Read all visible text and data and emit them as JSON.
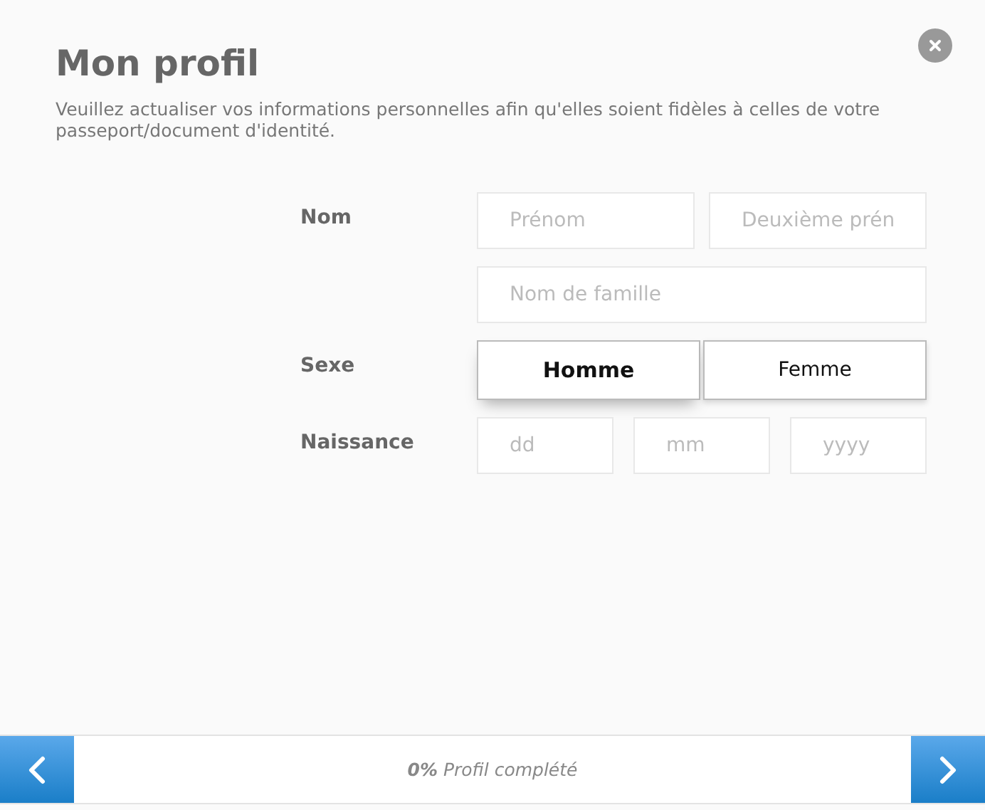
{
  "title": "Mon profil",
  "subtitle": "Veuillez actualiser vos informations personnelles afin qu'elles soient fidèles à celles de votre passeport/document d'identité.",
  "name_label": "Nom",
  "first_name": {
    "placeholder": "Prénom"
  },
  "middle_name": {
    "placeholder": "Deuxième prén"
  },
  "last_name": {
    "placeholder": "Nom de famille"
  },
  "sex_label": "Sexe",
  "sex_options": [
    {
      "label": "Homme",
      "selected": true
    },
    {
      "label": "Femme",
      "selected": false
    }
  ],
  "birth_label": "Naissance",
  "birth_fields": [
    {
      "placeholder": "dd"
    },
    {
      "placeholder": "mm"
    },
    {
      "placeholder": "yyyy"
    }
  ],
  "footer": {
    "progress_text": "**0%** Profil complété"
  }
}
